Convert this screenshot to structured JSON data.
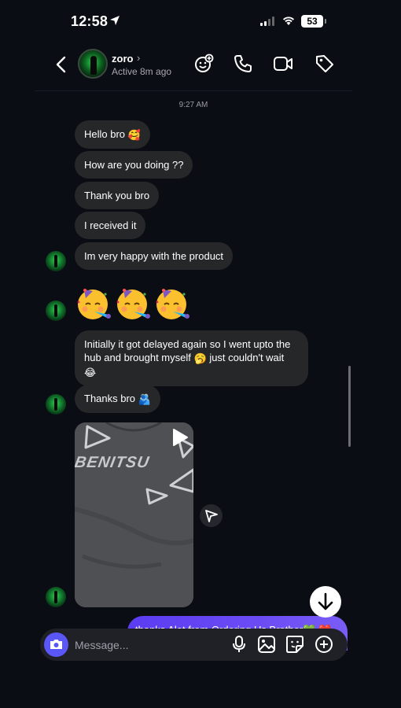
{
  "status_bar": {
    "time": "12:58",
    "battery": "53"
  },
  "header": {
    "name": "zoro",
    "chevron": "›",
    "active_status": "Active 8m ago"
  },
  "timestamp": "9:27 AM",
  "messages": [
    {
      "text": "Hello bro",
      "emoji": "🥰"
    },
    {
      "text": "How are you doing ??"
    },
    {
      "text": "Thank you bro"
    },
    {
      "text": "I received it"
    },
    {
      "text": "Im very happy with the product"
    },
    {
      "text": "Initially it got delayed again so I went upto the hub and brought myself",
      "emoji": "🥱",
      "text_after": "just couldn't wait",
      "emoji_end": "😂"
    },
    {
      "text": "Thanks bro",
      "emoji": "🫂"
    }
  ],
  "big_emojis": [
    "🥳",
    "🥳",
    "🥳"
  ],
  "photo": {
    "shirt_text": "BENITSU"
  },
  "sent_message": {
    "text": "thanks Alot from Ordering Us Brother💚 ❤️"
  },
  "composer": {
    "placeholder": "Message..."
  },
  "icons": {
    "back": "chevron-left-icon",
    "add_person": "add-person-icon",
    "call": "phone-icon",
    "video": "video-icon",
    "tag": "tag-icon",
    "camera": "camera-icon",
    "mic": "microphone-icon",
    "gallery": "gallery-icon",
    "sticker": "sticker-icon",
    "plus": "plus-icon"
  },
  "colors": {
    "accent": "#5b56f6",
    "bubble": "#262729",
    "background": "#0b0d14",
    "sent_gradient_start": "#5b3cf2"
  }
}
